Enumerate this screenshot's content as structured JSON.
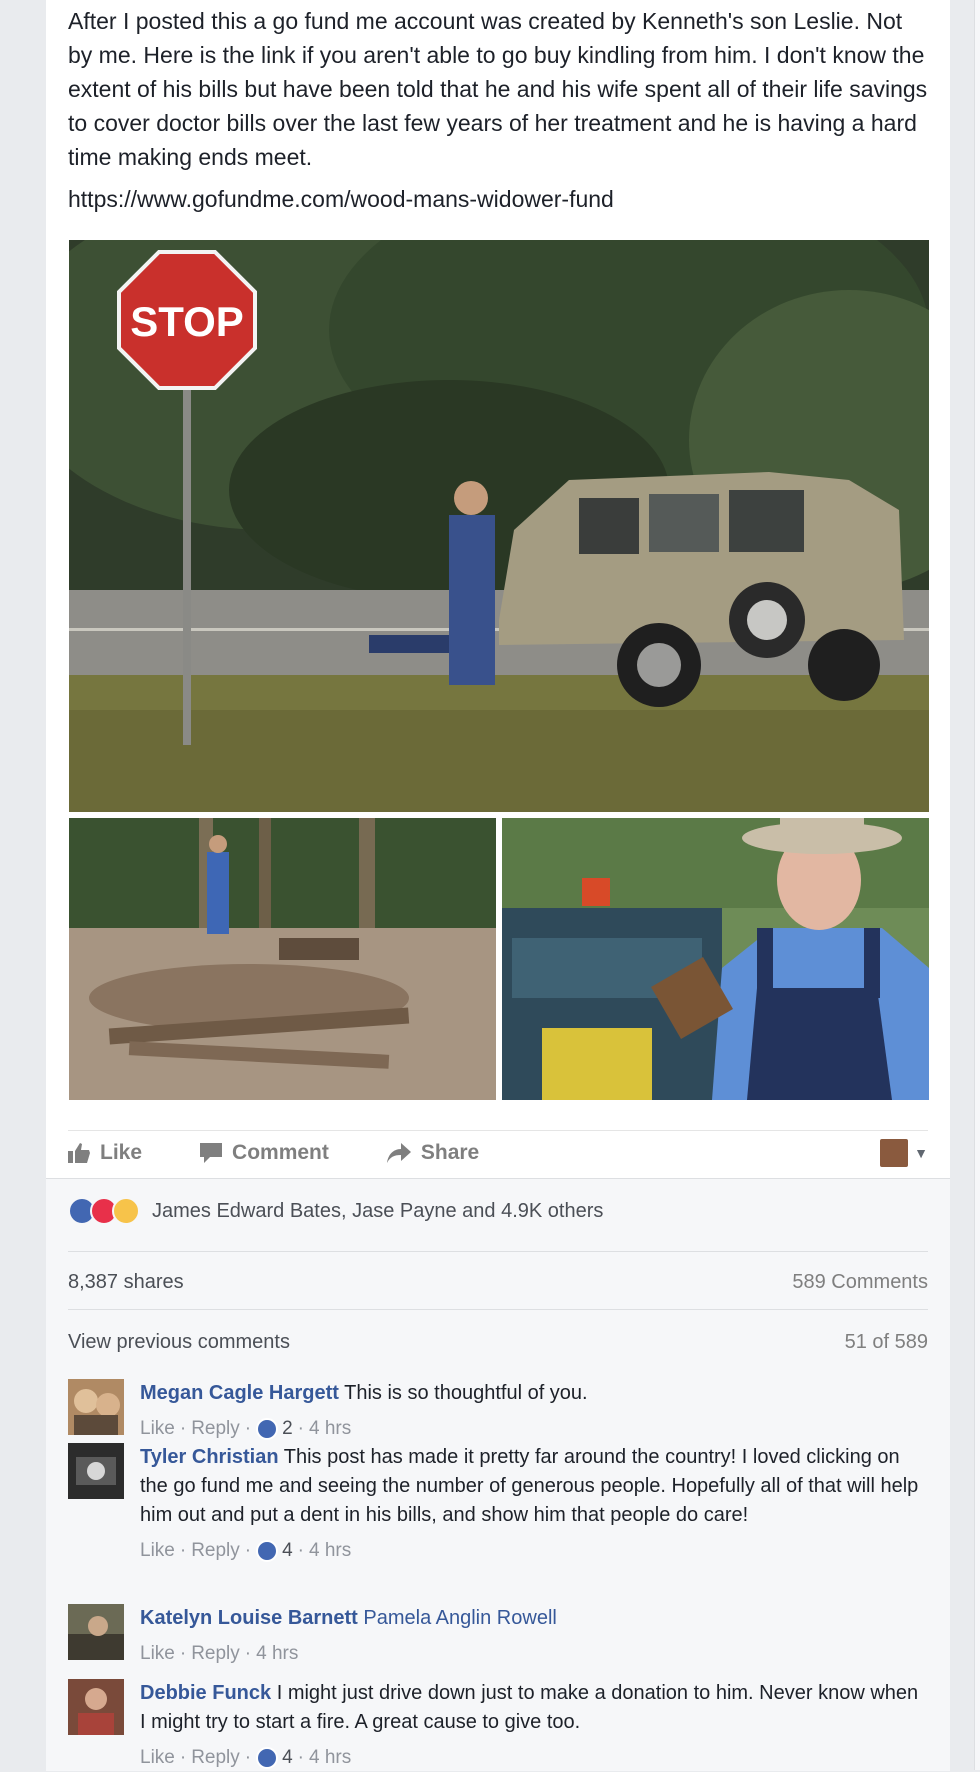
{
  "post": {
    "text": "After I posted this a go fund me account was created by Kenneth's son Leslie. Not by me. Here is the link if you aren't able to go buy kindling from him. I don't know the extent of his bills but have been told that he and his wife spent all of their life savings to cover doctor bills over the last few years of her treatment and he is having a hard time making ends meet.",
    "link": "https://www.gofundme.com/wood-mans-widower-fund",
    "stop_sign_text": "STOP"
  },
  "actions": {
    "like": "Like",
    "comment": "Comment",
    "share": "Share"
  },
  "stats": {
    "reactions_text": "James Edward Bates, Jase Payne and 4.9K others",
    "shares": "8,387 shares",
    "comments": "589 Comments",
    "view_previous": "View previous comments",
    "page_count": "51 of 589"
  },
  "comments": [
    {
      "author": "Megan Cagle Hargett",
      "text": "This is so thoughtful of you.",
      "like": "Like",
      "reply": "Reply",
      "likes": "2",
      "time": "4 hrs"
    },
    {
      "author": "Tyler Christian",
      "text": "This post has made it pretty far around the country! I loved clicking on the go fund me and seeing the number of generous people. Hopefully all of that will help him out and put a dent in his bills, and show him that people do care!",
      "like": "Like",
      "reply": "Reply",
      "likes": "4",
      "time": "4 hrs"
    },
    {
      "author": "Katelyn Louise Barnett",
      "tagged": "Pamela Anglin Rowell",
      "like": "Like",
      "reply": "Reply",
      "time": "4 hrs"
    },
    {
      "author": "Debbie Funck",
      "text": "I might just drive down just to make a donation to him. Never know when I might try to start a fire. A great cause to give too.",
      "like": "Like",
      "reply": "Reply",
      "likes": "4",
      "time": "4 hrs"
    }
  ],
  "colors": {
    "link_blue": "#365899",
    "like_blue": "#4267b2",
    "love_red": "#e8304a",
    "sad_yellow": "#f7c34a",
    "stop_red": "#c9302c"
  }
}
